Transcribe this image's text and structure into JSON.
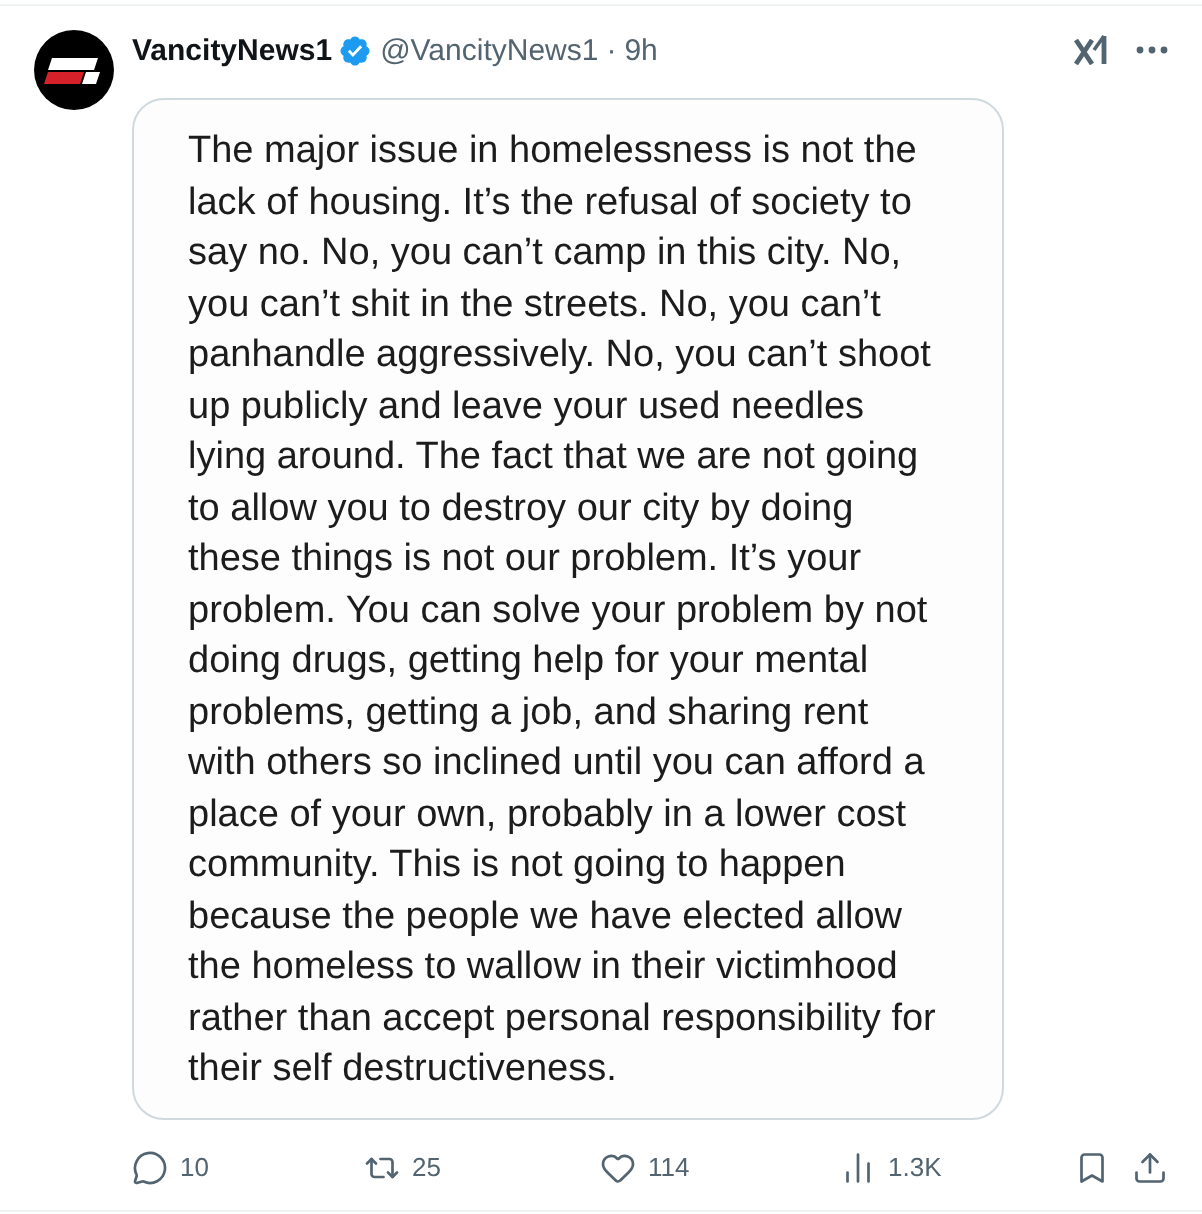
{
  "tweet": {
    "author": {
      "name": "VancityNews1",
      "verified": true,
      "handle": "@VancityNews1",
      "separator": "·",
      "time": "9h"
    },
    "image_text_lines": [
      "The major issue in homelessness is not the",
      "lack of housing. It’s the refusal of society to",
      "say no. No, you can’t camp in this city. No,",
      "you can’t shit in the streets. No, you can’t",
      "panhandle aggressively. No, you can’t shoot",
      "up publicly and leave your used needles",
      "lying around. The fact that we are not going",
      "to allow you to destroy our city by doing",
      "these things is not our problem. It’s your",
      "problem. You can solve your problem by not",
      "doing drugs, getting help for your mental",
      "problems, getting a job, and sharing rent",
      "with others so inclined until you can afford a",
      "place of your own, probably in a lower cost",
      "community. This is not going to happen",
      "because the people we have elected allow",
      "the homeless to wallow in their victimhood",
      "rather than accept personal responsibility for",
      "their self destructiveness."
    ],
    "actions": [
      {
        "kind": "reply",
        "count": "10"
      },
      {
        "kind": "retweet",
        "count": "25"
      },
      {
        "kind": "like",
        "count": "114"
      },
      {
        "kind": "views",
        "count": "1.3K"
      }
    ],
    "extra_actions": [
      {
        "kind": "bookmark"
      },
      {
        "kind": "share"
      }
    ]
  }
}
